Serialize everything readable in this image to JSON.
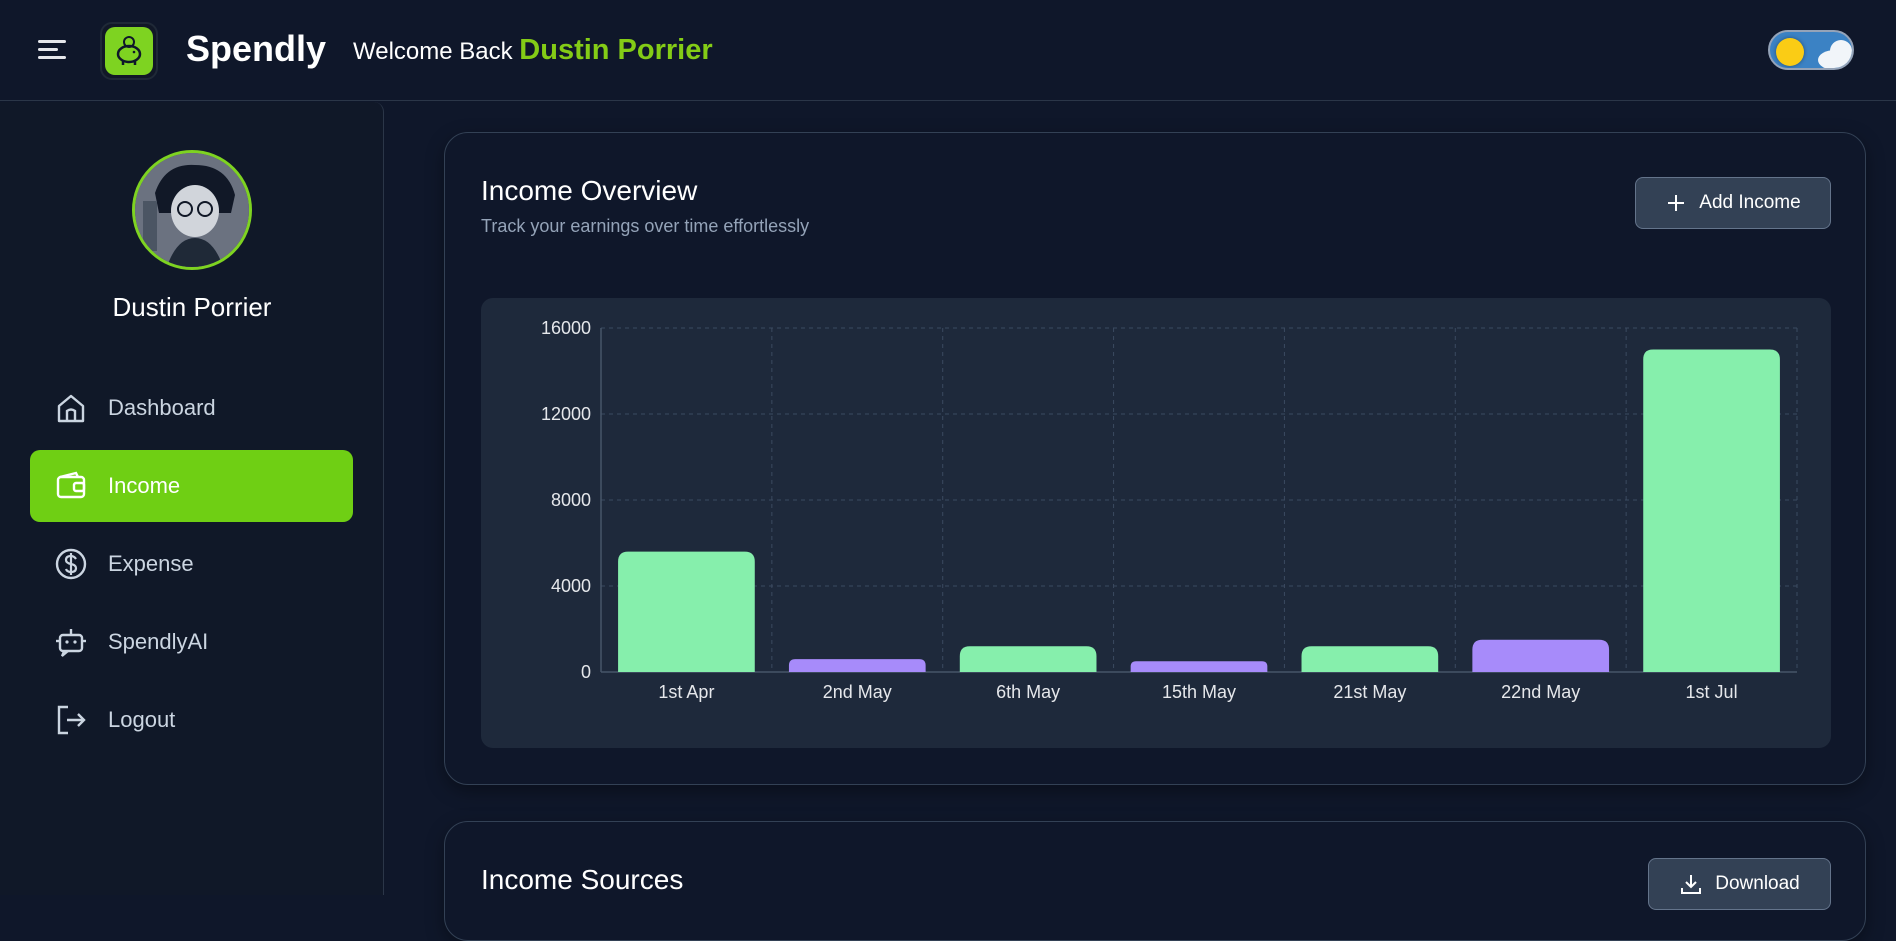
{
  "header": {
    "brand": "Spendly",
    "welcome": "Welcome Back",
    "user_name": "Dustin Porrier"
  },
  "sidebar": {
    "profile_name": "Dustin Porrier",
    "items": [
      {
        "label": "Dashboard",
        "icon": "home-icon"
      },
      {
        "label": "Income",
        "icon": "wallet-icon",
        "active": true
      },
      {
        "label": "Expense",
        "icon": "dollar-circle-icon"
      },
      {
        "label": "SpendlyAI",
        "icon": "bot-icon"
      },
      {
        "label": "Logout",
        "icon": "logout-icon"
      }
    ]
  },
  "income_overview": {
    "title": "Income Overview",
    "subtitle": "Track your earnings over time effortlessly",
    "add_button": "Add Income"
  },
  "income_sources": {
    "title": "Income Sources",
    "download_button": "Download"
  },
  "colors": {
    "accent": "#6fcf14",
    "bar_green": "#86efac",
    "bar_purple": "#a78bfa"
  },
  "chart_data": {
    "type": "bar",
    "categories": [
      "1st Apr",
      "2nd May",
      "6th May",
      "15th May",
      "21st May",
      "22nd May",
      "1st Jul"
    ],
    "values": [
      5600,
      600,
      1200,
      500,
      1200,
      1500,
      15000
    ],
    "bar_colors": [
      "#86efac",
      "#a78bfa",
      "#86efac",
      "#a78bfa",
      "#86efac",
      "#a78bfa",
      "#86efac"
    ],
    "yticks": [
      "0",
      "4000",
      "8000",
      "12000",
      "16000"
    ],
    "ylim": [
      0,
      16000
    ],
    "grid": true
  }
}
